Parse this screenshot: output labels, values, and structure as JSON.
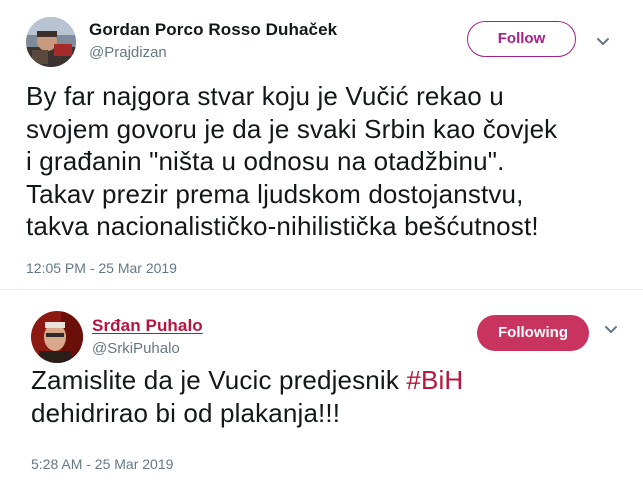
{
  "tweets": [
    {
      "author": {
        "display_name": "Gordan Porco Rosso Duhaček",
        "handle": "@Prajdizan"
      },
      "follow_button": {
        "label": "Follow",
        "state": "not-following",
        "color": "#a61f87"
      },
      "menu_icon": "chevron-down-icon",
      "text_lines": [
        "By far najgora stvar koju je Vučić rekao u",
        "svojem govoru je da je svaki Srbin kao čovjek",
        "i građanin \"ništa u odnosu na otadžbinu\".",
        "Takav prezir prema ljudskom dostojanstvu,",
        "takva nacionalističko-nihilistička bešćutnost!"
      ],
      "timestamp": "12:05 PM - 25 Mar 2019"
    },
    {
      "author": {
        "display_name": "Srđan Puhalo",
        "handle": "@SrkiPuhalo",
        "name_color": "#b8143e"
      },
      "follow_button": {
        "label": "Following",
        "state": "following",
        "color": "#c8335f"
      },
      "menu_icon": "chevron-down-icon",
      "text_lines": [
        {
          "prefix": "Zamislite da je Vucic predjesnik ",
          "hashtag": "#BiH"
        },
        "dehidrirao bi od plakanja!!!"
      ],
      "timestamp": "5:28 AM - 25 Mar 2019"
    }
  ]
}
